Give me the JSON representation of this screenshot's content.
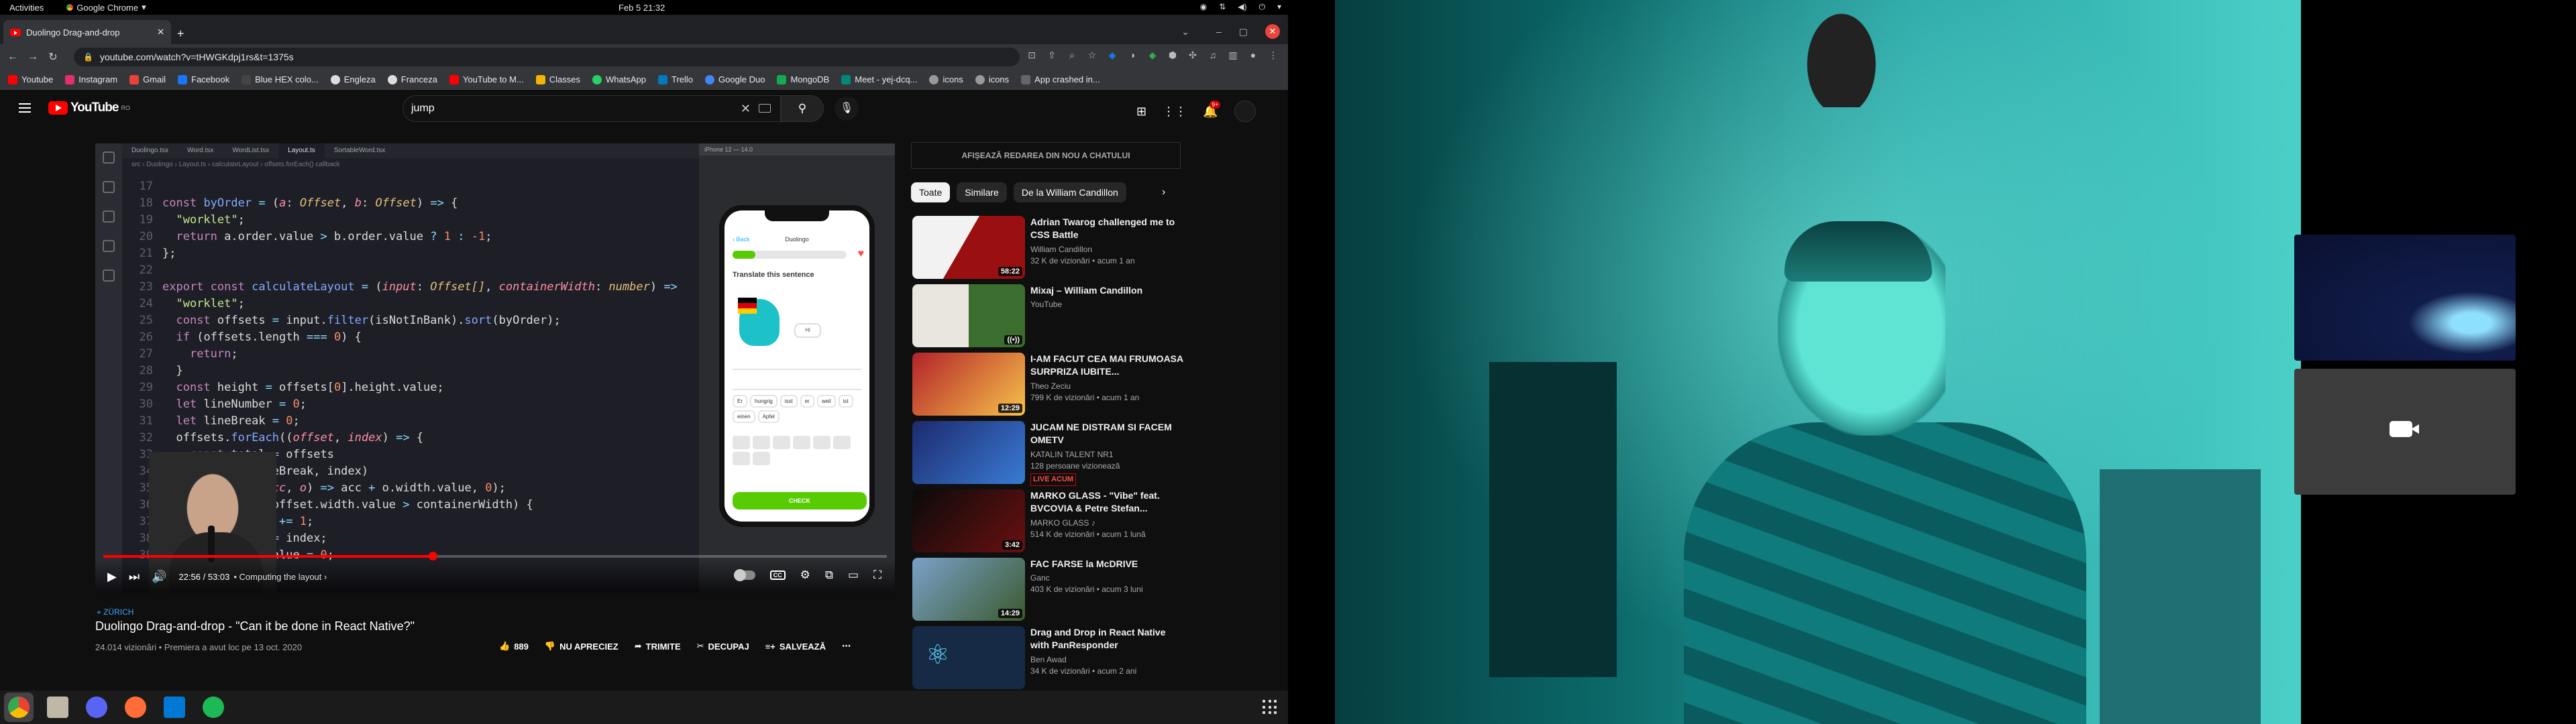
{
  "topbar": {
    "activities": "Activities",
    "app_name": "Google Chrome",
    "clock": "Feb 5  21:32"
  },
  "chrome": {
    "tab_title": "Duolingo Drag-and-drop",
    "url": "youtube.com/watch?v=tHWGKdpj1rs&t=1375s",
    "bookmarks": [
      "Youtube",
      "Instagram",
      "Gmail",
      "Facebook",
      "Blue HEX colo...",
      "Engleza",
      "Franceza",
      "YouTube to M...",
      "Classes",
      "WhatsApp",
      "Trello",
      "Google Duo",
      "MongoDB",
      "Meet - yej-dcq...",
      "icons",
      "icons",
      "App crashed in..."
    ],
    "bookmark_colors": [
      "#ff0000",
      "#e1306c",
      "#ea4335",
      "#1877f2",
      "#444",
      "#ddd",
      "#ddd",
      "#ff0000",
      "#f4b400",
      "#25d366",
      "#0079bf",
      "#4285f4",
      "#13aa52",
      "#00897b",
      "#999",
      "#999",
      "#666"
    ]
  },
  "youtube": {
    "logo": "YouTube",
    "logo_region": "RO",
    "search_value": "jump",
    "notifications": "9+"
  },
  "player": {
    "time": "22:56 / 53:03",
    "chapter": "Computing the layout",
    "vscode_tabs": [
      "Duolingo.tsx",
      "Word.tsx",
      "WordList.tsx",
      "Layout.ts",
      "SortableWord.tsx"
    ],
    "breadcrumb": "src › Duolingo › Layout.ts › calculateLayout › offsets.forEach() callback",
    "phone": {
      "back": "Back",
      "header": "Duolingo",
      "title": "Translate this sentence",
      "bubble": "Hi",
      "words": [
        "Er",
        "hungrig",
        "isst",
        "er",
        "weil",
        "ist",
        "einen",
        "Apfel"
      ],
      "check": "CHECK"
    }
  },
  "video": {
    "location": "ZÜRICH",
    "title": "Duolingo Drag-and-drop - \"Can it be done in React Native?\"",
    "meta": "24.014 vizionări • Premiera a avut loc pe 13 oct. 2020",
    "likes": "889",
    "dislike": "NU APRECIEZ",
    "share": "TRIMITE",
    "clip": "DECUPAJ",
    "save": "SALVEAZĂ"
  },
  "sidebar": {
    "chat_replay": "AFIȘEAZĂ REDAREA DIN NOU A CHATULUI",
    "chips": [
      "Toate",
      "Similare",
      "De la William Candillon"
    ],
    "videos": [
      {
        "title": "Adrian Twarog challenged me to CSS Battle",
        "channel": "William Candillon",
        "meta": "32 K de vizionări • acum 1 an",
        "duration": "58:22",
        "thumb": "#9a1010"
      },
      {
        "title": "Mixaj – William Candillon",
        "channel": "YouTube",
        "meta": "",
        "duration": "",
        "thumb": "#3b6d2f"
      },
      {
        "title": "I-AM FACUT CEA MAI FRUMOASA SURPRIZA IUBITE...",
        "channel": "Theo Zeciu",
        "meta": "799 K de vizionări • acum 1 an",
        "duration": "12:29",
        "thumb": "#b2222a"
      },
      {
        "title": "JUCAM NE DISTRAM SI FACEM OMETV",
        "channel": "KATALIN TALENT NR1",
        "meta": "128 persoane vizionează",
        "duration": "",
        "live": "LIVE ACUM",
        "thumb": "#1c2a6c"
      },
      {
        "title": "MARKO GLASS - \"Vibe\" feat. BVCOVIA & Petre Stefan...",
        "channel": "MARKO GLASS ♪",
        "meta": "514 K de vizionări • acum 1 lună",
        "duration": "3:42",
        "thumb": "#3a0a0a"
      },
      {
        "title": "FAC FARSE la McDRIVE",
        "channel": "Ganc",
        "meta": "403 K de vizionări • acum 3 luni",
        "duration": "14:29",
        "thumb": "#3b5a2f"
      },
      {
        "title": "Drag and Drop in React Native with PanResponder",
        "channel": "Ben Awad",
        "meta": "34 K de vizionări • acum 2 ani",
        "duration": "",
        "thumb": "#162a46"
      }
    ]
  }
}
